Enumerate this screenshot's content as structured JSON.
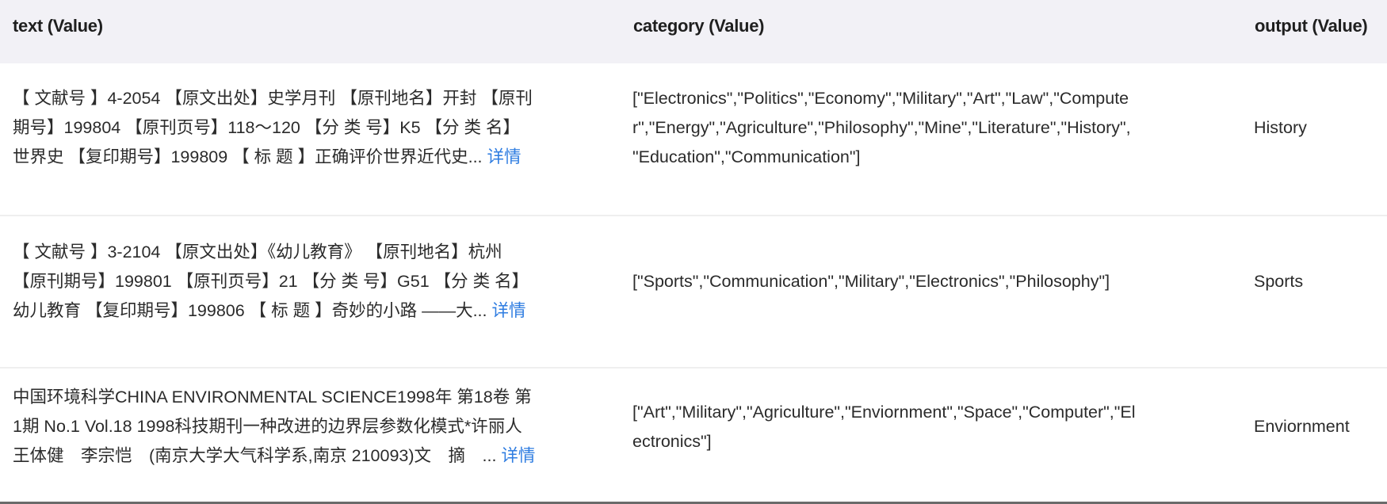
{
  "table": {
    "headers": {
      "text": "text (Value)",
      "category": "category (Value)",
      "output": "output (Value)"
    },
    "detail_label": "详情",
    "rows": [
      {
        "text_lines": [
          "【 文献号 】4-2054 【原文出处】史学月刊 【原刊地名】开封 【原刊",
          "期号】199804 【原刊页号】118～120 【分 类 号】K5 【分 类 名】",
          "世界史 【复印期号】199809 【 标 题 】正确评价世界近代史... "
        ],
        "category": "[\"Electronics\",\"Politics\",\"Economy\",\"Military\",\"Art\",\"Law\",\"Computer\",\"Energy\",\"Agriculture\",\"Philosophy\",\"Mine\",\"Literature\",\"History\",\"Education\",\"Communication\"]",
        "category_lines": [
          "[\"Electronics\",\"Politics\",\"Economy\",\"Military\",\"Art\",\"Law\",\"Compute",
          "r\",\"Energy\",\"Agriculture\",\"Philosophy\",\"Mine\",\"Literature\",\"History\",",
          "\"Education\",\"Communication\"]"
        ],
        "output": "History"
      },
      {
        "text_lines": [
          "【 文献号 】3-2104 【原文出处】《幼儿教育》 【原刊地名】杭州",
          "【原刊期号】199801 【原刊页号】21 【分 类 号】G51 【分 类 名】",
          "幼儿教育 【复印期号】199806 【 标 题 】奇妙的小路 ——大... "
        ],
        "category": "[\"Sports\",\"Communication\",\"Military\",\"Electronics\",\"Philosophy\"]",
        "category_lines": [
          "[\"Sports\",\"Communication\",\"Military\",\"Electronics\",\"Philosophy\"]"
        ],
        "output": "Sports"
      },
      {
        "text_lines": [
          "中国环境科学CHINA ENVIRONMENTAL SCIENCE1998年 第18卷 第",
          "1期 No.1 Vol.18 1998科技期刊一种改进的边界层参数化模式*许丽人",
          "王体健　李宗恺　(南京大学大气科学系,南京 210093)文　摘　... "
        ],
        "category": "[\"Art\",\"Military\",\"Agriculture\",\"Enviornment\",\"Space\",\"Computer\",\"Electronics\"]",
        "category_lines": [
          "[\"Art\",\"Military\",\"Agriculture\",\"Enviornment\",\"Space\",\"Computer\",\"El",
          "ectronics\"]"
        ],
        "output": "Enviornment"
      }
    ]
  },
  "colors": {
    "header_bg": "#f2f1f6",
    "link": "#2f7de1",
    "text": "#2b2b2b"
  }
}
